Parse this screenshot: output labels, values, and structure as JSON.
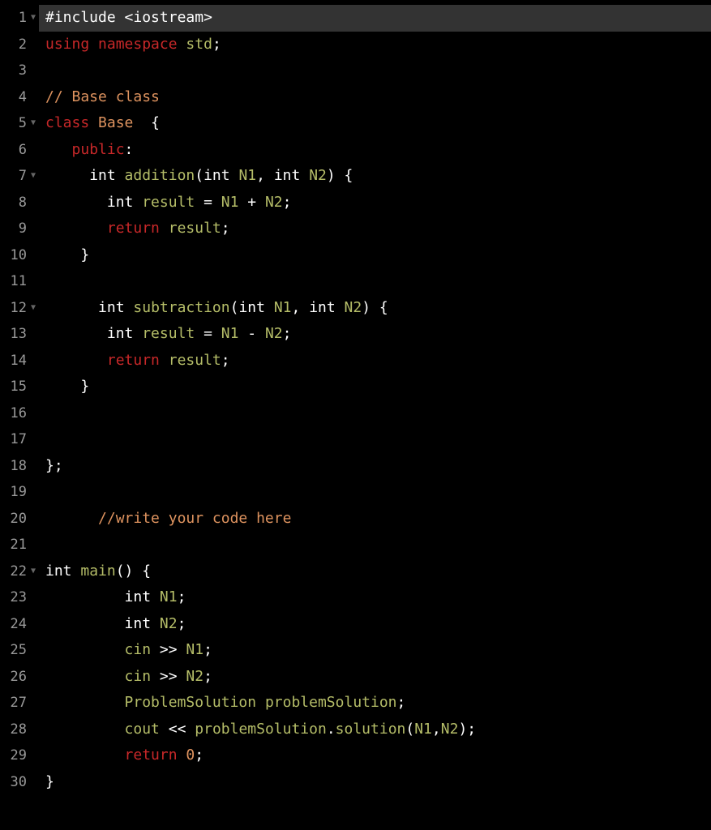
{
  "lines": [
    {
      "num": 1,
      "fold": true,
      "highlighted": true,
      "tokens": [
        {
          "t": "#include",
          "c": "tok-preproc"
        },
        {
          "t": " ",
          "c": ""
        },
        {
          "t": "<iostream>",
          "c": "tok-preproc"
        }
      ]
    },
    {
      "num": 2,
      "fold": false,
      "highlighted": false,
      "tokens": [
        {
          "t": "using",
          "c": "tok-keyword"
        },
        {
          "t": " ",
          "c": ""
        },
        {
          "t": "namespace",
          "c": "tok-keyword"
        },
        {
          "t": " ",
          "c": ""
        },
        {
          "t": "std",
          "c": "tok-var"
        },
        {
          "t": ";",
          "c": "tok-punct"
        }
      ]
    },
    {
      "num": 3,
      "fold": false,
      "highlighted": false,
      "tokens": []
    },
    {
      "num": 4,
      "fold": false,
      "highlighted": false,
      "tokens": [
        {
          "t": "// Base class",
          "c": "tok-comment"
        }
      ]
    },
    {
      "num": 5,
      "fold": true,
      "highlighted": false,
      "tokens": [
        {
          "t": "class",
          "c": "tok-keyword"
        },
        {
          "t": " ",
          "c": ""
        },
        {
          "t": "Base",
          "c": "tok-class"
        },
        {
          "t": "  {",
          "c": "tok-punct"
        }
      ]
    },
    {
      "num": 6,
      "fold": false,
      "highlighted": false,
      "tokens": [
        {
          "t": "   ",
          "c": ""
        },
        {
          "t": "public",
          "c": "tok-public"
        },
        {
          "t": ":",
          "c": "tok-punct"
        }
      ]
    },
    {
      "num": 7,
      "fold": true,
      "highlighted": false,
      "tokens": [
        {
          "t": "     ",
          "c": ""
        },
        {
          "t": "int",
          "c": "tok-int"
        },
        {
          "t": " ",
          "c": ""
        },
        {
          "t": "addition",
          "c": "tok-func"
        },
        {
          "t": "(",
          "c": "tok-punct"
        },
        {
          "t": "int",
          "c": "tok-int"
        },
        {
          "t": " ",
          "c": ""
        },
        {
          "t": "N1",
          "c": "tok-var"
        },
        {
          "t": ", ",
          "c": "tok-punct"
        },
        {
          "t": "int",
          "c": "tok-int"
        },
        {
          "t": " ",
          "c": ""
        },
        {
          "t": "N2",
          "c": "tok-var"
        },
        {
          "t": ") {",
          "c": "tok-punct"
        }
      ]
    },
    {
      "num": 8,
      "fold": false,
      "highlighted": false,
      "tokens": [
        {
          "t": "       ",
          "c": ""
        },
        {
          "t": "int",
          "c": "tok-int"
        },
        {
          "t": " ",
          "c": ""
        },
        {
          "t": "result",
          "c": "tok-var"
        },
        {
          "t": " = ",
          "c": "tok-op"
        },
        {
          "t": "N1",
          "c": "tok-var"
        },
        {
          "t": " + ",
          "c": "tok-op"
        },
        {
          "t": "N2",
          "c": "tok-var"
        },
        {
          "t": ";",
          "c": "tok-punct"
        }
      ]
    },
    {
      "num": 9,
      "fold": false,
      "highlighted": false,
      "tokens": [
        {
          "t": "       ",
          "c": ""
        },
        {
          "t": "return",
          "c": "tok-return"
        },
        {
          "t": " ",
          "c": ""
        },
        {
          "t": "result",
          "c": "tok-var"
        },
        {
          "t": ";",
          "c": "tok-punct"
        }
      ]
    },
    {
      "num": 10,
      "fold": false,
      "highlighted": false,
      "tokens": [
        {
          "t": "    }",
          "c": "tok-punct"
        }
      ]
    },
    {
      "num": 11,
      "fold": false,
      "highlighted": false,
      "tokens": []
    },
    {
      "num": 12,
      "fold": true,
      "highlighted": false,
      "tokens": [
        {
          "t": "      ",
          "c": ""
        },
        {
          "t": "int",
          "c": "tok-int"
        },
        {
          "t": " ",
          "c": ""
        },
        {
          "t": "subtraction",
          "c": "tok-func"
        },
        {
          "t": "(",
          "c": "tok-punct"
        },
        {
          "t": "int",
          "c": "tok-int"
        },
        {
          "t": " ",
          "c": ""
        },
        {
          "t": "N1",
          "c": "tok-var"
        },
        {
          "t": ", ",
          "c": "tok-punct"
        },
        {
          "t": "int",
          "c": "tok-int"
        },
        {
          "t": " ",
          "c": ""
        },
        {
          "t": "N2",
          "c": "tok-var"
        },
        {
          "t": ") {",
          "c": "tok-punct"
        }
      ]
    },
    {
      "num": 13,
      "fold": false,
      "highlighted": false,
      "tokens": [
        {
          "t": "       ",
          "c": ""
        },
        {
          "t": "int",
          "c": "tok-int"
        },
        {
          "t": " ",
          "c": ""
        },
        {
          "t": "result",
          "c": "tok-var"
        },
        {
          "t": " = ",
          "c": "tok-op"
        },
        {
          "t": "N1",
          "c": "tok-var"
        },
        {
          "t": " - ",
          "c": "tok-op"
        },
        {
          "t": "N2",
          "c": "tok-var"
        },
        {
          "t": ";",
          "c": "tok-punct"
        }
      ]
    },
    {
      "num": 14,
      "fold": false,
      "highlighted": false,
      "tokens": [
        {
          "t": "       ",
          "c": ""
        },
        {
          "t": "return",
          "c": "tok-return"
        },
        {
          "t": " ",
          "c": ""
        },
        {
          "t": "result",
          "c": "tok-var"
        },
        {
          "t": ";",
          "c": "tok-punct"
        }
      ]
    },
    {
      "num": 15,
      "fold": false,
      "highlighted": false,
      "tokens": [
        {
          "t": "    }",
          "c": "tok-punct"
        }
      ]
    },
    {
      "num": 16,
      "fold": false,
      "highlighted": false,
      "tokens": []
    },
    {
      "num": 17,
      "fold": false,
      "highlighted": false,
      "tokens": []
    },
    {
      "num": 18,
      "fold": false,
      "highlighted": false,
      "tokens": [
        {
          "t": "};",
          "c": "tok-punct"
        }
      ]
    },
    {
      "num": 19,
      "fold": false,
      "highlighted": false,
      "tokens": []
    },
    {
      "num": 20,
      "fold": false,
      "highlighted": false,
      "tokens": [
        {
          "t": "      ",
          "c": ""
        },
        {
          "t": "//write your code here",
          "c": "tok-comment"
        }
      ]
    },
    {
      "num": 21,
      "fold": false,
      "highlighted": false,
      "tokens": []
    },
    {
      "num": 22,
      "fold": true,
      "highlighted": false,
      "tokens": [
        {
          "t": "int",
          "c": "tok-int"
        },
        {
          "t": " ",
          "c": ""
        },
        {
          "t": "main",
          "c": "tok-func"
        },
        {
          "t": "() {",
          "c": "tok-punct"
        }
      ]
    },
    {
      "num": 23,
      "fold": false,
      "highlighted": false,
      "tokens": [
        {
          "t": "         ",
          "c": ""
        },
        {
          "t": "int",
          "c": "tok-int"
        },
        {
          "t": " ",
          "c": ""
        },
        {
          "t": "N1",
          "c": "tok-var"
        },
        {
          "t": ";",
          "c": "tok-punct"
        }
      ]
    },
    {
      "num": 24,
      "fold": false,
      "highlighted": false,
      "tokens": [
        {
          "t": "         ",
          "c": ""
        },
        {
          "t": "int",
          "c": "tok-int"
        },
        {
          "t": " ",
          "c": ""
        },
        {
          "t": "N2",
          "c": "tok-var"
        },
        {
          "t": ";",
          "c": "tok-punct"
        }
      ]
    },
    {
      "num": 25,
      "fold": false,
      "highlighted": false,
      "tokens": [
        {
          "t": "         ",
          "c": ""
        },
        {
          "t": "cin",
          "c": "tok-var"
        },
        {
          "t": " >> ",
          "c": "tok-op"
        },
        {
          "t": "N1",
          "c": "tok-var"
        },
        {
          "t": ";",
          "c": "tok-punct"
        }
      ]
    },
    {
      "num": 26,
      "fold": false,
      "highlighted": false,
      "tokens": [
        {
          "t": "         ",
          "c": ""
        },
        {
          "t": "cin",
          "c": "tok-var"
        },
        {
          "t": " >> ",
          "c": "tok-op"
        },
        {
          "t": "N2",
          "c": "tok-var"
        },
        {
          "t": ";",
          "c": "tok-punct"
        }
      ]
    },
    {
      "num": 27,
      "fold": false,
      "highlighted": false,
      "tokens": [
        {
          "t": "         ",
          "c": ""
        },
        {
          "t": "ProblemSolution",
          "c": "tok-var"
        },
        {
          "t": " ",
          "c": ""
        },
        {
          "t": "problemSolution",
          "c": "tok-var"
        },
        {
          "t": ";",
          "c": "tok-punct"
        }
      ]
    },
    {
      "num": 28,
      "fold": false,
      "highlighted": false,
      "tokens": [
        {
          "t": "         ",
          "c": ""
        },
        {
          "t": "cout",
          "c": "tok-var"
        },
        {
          "t": " << ",
          "c": "tok-op"
        },
        {
          "t": "problemSolution",
          "c": "tok-var"
        },
        {
          "t": ".",
          "c": "tok-punct"
        },
        {
          "t": "solution",
          "c": "tok-func"
        },
        {
          "t": "(",
          "c": "tok-punct"
        },
        {
          "t": "N1",
          "c": "tok-var"
        },
        {
          "t": ",",
          "c": "tok-punct"
        },
        {
          "t": "N2",
          "c": "tok-var"
        },
        {
          "t": ");",
          "c": "tok-punct"
        }
      ]
    },
    {
      "num": 29,
      "fold": false,
      "highlighted": false,
      "tokens": [
        {
          "t": "         ",
          "c": ""
        },
        {
          "t": "return",
          "c": "tok-return"
        },
        {
          "t": " ",
          "c": ""
        },
        {
          "t": "0",
          "c": "tok-num"
        },
        {
          "t": ";",
          "c": "tok-punct"
        }
      ]
    },
    {
      "num": 30,
      "fold": false,
      "highlighted": false,
      "tokens": [
        {
          "t": "}",
          "c": "tok-punct"
        }
      ]
    }
  ]
}
